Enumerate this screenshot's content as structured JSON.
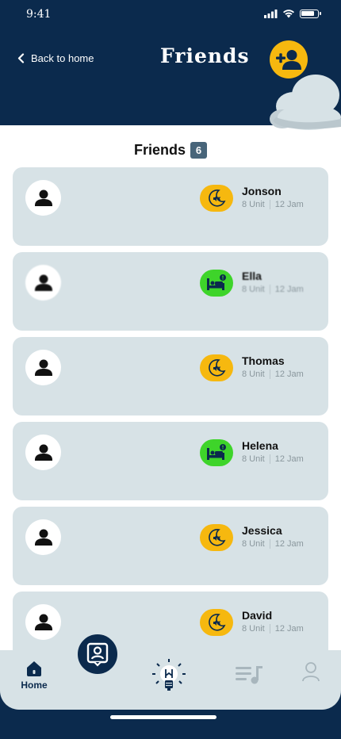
{
  "status_bar": {
    "time": "9:41"
  },
  "header": {
    "back_label": "Back to home",
    "title": "Friends",
    "add_friend_icon": "person-add-icon"
  },
  "friends_section": {
    "label": "Friends",
    "count": "6"
  },
  "friends": [
    {
      "name": "Jonson",
      "unit": "8 Unit",
      "hours": "12 Jam",
      "status": "sleep"
    },
    {
      "name": "Ella",
      "unit": "8 Unit",
      "hours": "12 Jam",
      "status": "awake"
    },
    {
      "name": "Thomas",
      "unit": "8 Unit",
      "hours": "12 Jam",
      "status": "sleep"
    },
    {
      "name": "Helena",
      "unit": "8 Unit",
      "hours": "12 Jam",
      "status": "awake"
    },
    {
      "name": "Jessica",
      "unit": "8 Unit",
      "hours": "12 Jam",
      "status": "sleep"
    },
    {
      "name": "David",
      "unit": "8 Unit",
      "hours": "12 Jam",
      "status": "sleep"
    }
  ],
  "tab_bar": {
    "home_label": "Home",
    "icons": [
      "home-icon",
      "profile-card-icon",
      "lightbulb-icon",
      "playlist-icon",
      "user-icon"
    ]
  },
  "colors": {
    "navy": "#0b2a4d",
    "yellow": "#f6b80f",
    "green": "#3ed42a",
    "card": "#d7e2e6",
    "badge": "#48657a"
  }
}
